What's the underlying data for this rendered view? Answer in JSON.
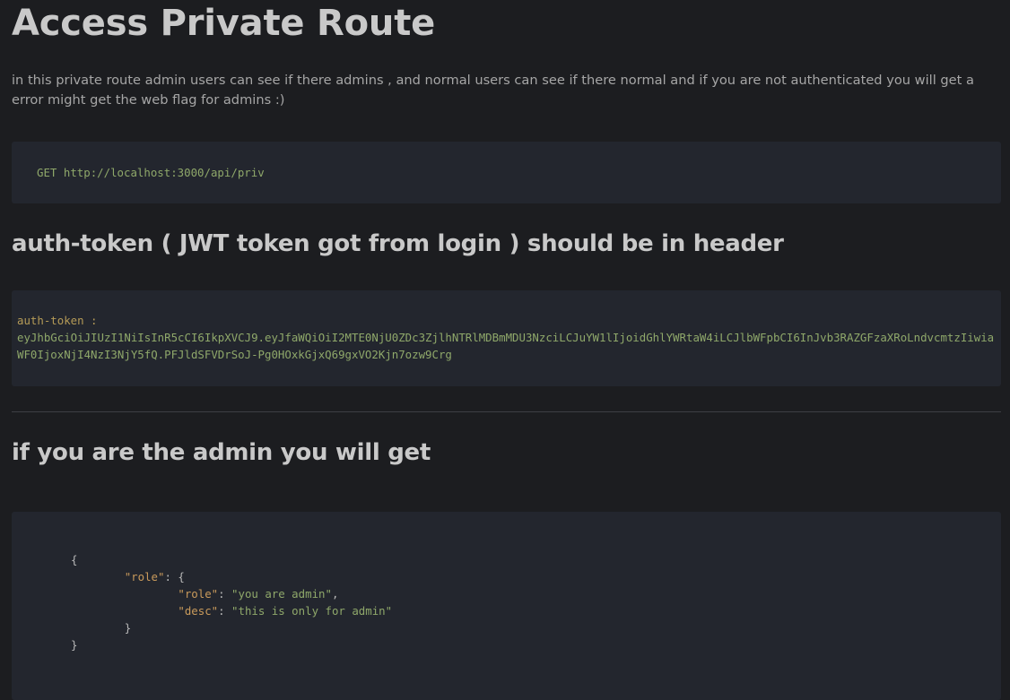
{
  "page": {
    "title": "Access Private Route",
    "intro": "in this private route admin users can see if there admins , and normal users can see if there normal and if you are not authenticated you will get a error might get the web flag for admins :)"
  },
  "request": {
    "method": "GET",
    "url": "http://localhost:3000/api/priv"
  },
  "token_section": {
    "heading": "auth-token ( JWT token got from login ) should be in header",
    "key_label": "auth-token :",
    "value": "eyJhbGciOiJIUzI1NiIsInR5cCI6IkpXVCJ9.eyJfaWQiOiI2MTE0NjU0ZDc3ZjlhNTRlMDBmMDU3NzciLCJuYW1lIjoidGhlYWRtaW4iLCJlbWFpbCI6InJvb3RAZGFzaXRoLndvcmtzIiwiaWF0IjoxNjI4NzI3NjY5fQ.PFJldSFVDrSoJ-Pg0HOxkGjxQ69gxVO2Kjn7ozw9Crg"
  },
  "admin_section": {
    "heading": "if you are the admin you will get",
    "json": {
      "open_brace": "{",
      "role_key": "\"role\"",
      "role_open": ": {",
      "inner_role_key": "\"role\"",
      "inner_role_val": "\"you are admin\"",
      "desc_key": "\"desc\"",
      "desc_val": "\"this is only for admin\"",
      "inner_close": "}",
      "close_brace": "}"
    }
  },
  "colors": {
    "background": "#1c1d20",
    "code_background": "#23262e",
    "string_green": "#8fa86a",
    "key_orange": "#c99a5b"
  }
}
